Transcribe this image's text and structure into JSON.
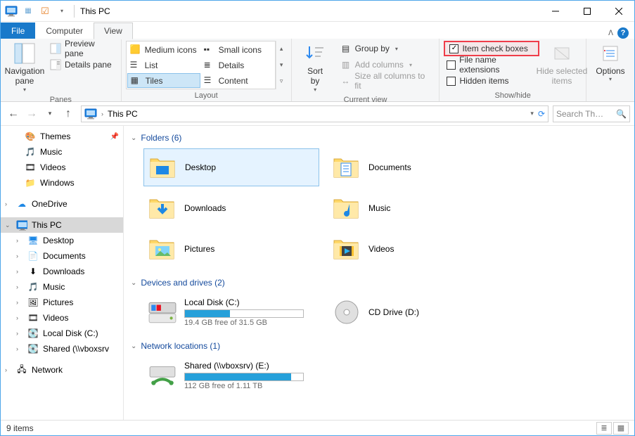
{
  "window": {
    "title": "This PC"
  },
  "tabs": {
    "file": "File",
    "computer": "Computer",
    "view": "View"
  },
  "ribbon": {
    "panes_group": "Panes",
    "nav_pane": "Navigation\npane",
    "preview_pane": "Preview pane",
    "details_pane": "Details pane",
    "layout_group": "Layout",
    "layout": {
      "medium": "Medium icons",
      "small": "Small icons",
      "list": "List",
      "details": "Details",
      "tiles": "Tiles",
      "content": "Content"
    },
    "current_view_group": "Current view",
    "sort_by": "Sort\nby",
    "group_by": "Group by",
    "add_columns": "Add columns",
    "size_cols": "Size all columns to fit",
    "show_hide_group": "Show/hide",
    "item_checkboxes": "Item check boxes",
    "file_ext": "File name extensions",
    "hidden_items": "Hidden items",
    "hide_selected": "Hide selected\nitems",
    "options": "Options"
  },
  "addr": {
    "location": "This PC",
    "search_placeholder": "Search Th…"
  },
  "tree": {
    "themes": "Themes",
    "music_q": "Music",
    "videos_q": "Videos",
    "windows_q": "Windows",
    "onedrive": "OneDrive",
    "thispc": "This PC",
    "desktop": "Desktop",
    "documents": "Documents",
    "downloads": "Downloads",
    "music": "Music",
    "pictures": "Pictures",
    "videos": "Videos",
    "localdisk": "Local Disk (C:)",
    "shared": "Shared (\\\\vboxsrv",
    "network": "Network"
  },
  "sections": {
    "folders": "Folders (6)",
    "drives": "Devices and drives (2)",
    "netloc": "Network locations (1)"
  },
  "folders": {
    "desktop": "Desktop",
    "documents": "Documents",
    "downloads": "Downloads",
    "music": "Music",
    "pictures": "Pictures",
    "videos": "Videos"
  },
  "drives": {
    "local_name": "Local Disk (C:)",
    "local_free": "19.4 GB free of 31.5 GB",
    "local_pct": 38,
    "cd_name": "CD Drive (D:)"
  },
  "netloc": {
    "name": "Shared (\\\\vboxsrv) (E:)",
    "free": "112 GB free of 1.11 TB",
    "pct": 90
  },
  "status": {
    "count": "9 items"
  }
}
